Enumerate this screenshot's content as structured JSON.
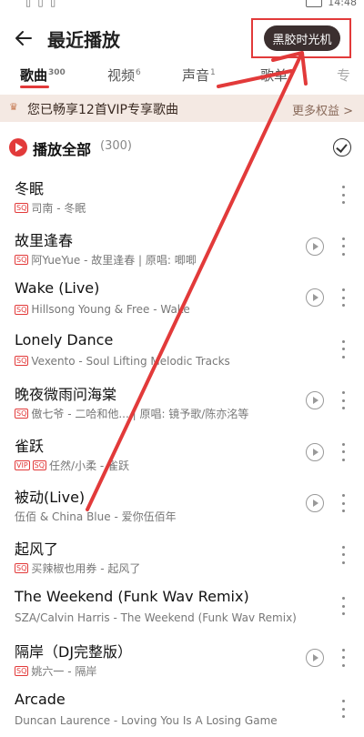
{
  "status": {
    "left_icons": "▯ ▯ ▯",
    "time": "14:48"
  },
  "header": {
    "title": "最近播放",
    "vinyl_button": "黑胶时光机"
  },
  "tabs": [
    {
      "label": "歌曲",
      "count": "300"
    },
    {
      "label": "视频",
      "count": "6"
    },
    {
      "label": "声音",
      "count": "1"
    },
    {
      "label": "歌单",
      "count": ""
    },
    {
      "label": "专",
      "count": ""
    }
  ],
  "vip_banner": {
    "text": "您已畅享12首VIP专享歌曲",
    "more": "更多权益 >"
  },
  "play_all": {
    "label": "播放全部",
    "count": "(300)"
  },
  "songs": [
    {
      "name": "冬眠",
      "meta": "司南 - 冬眠",
      "badges": [
        "SQ"
      ],
      "mv": false
    },
    {
      "name": "故里逢春",
      "meta": "阿YueYue - 故里逢春 | 原唱: 唧唧",
      "badges": [
        "SQ"
      ],
      "mv": true
    },
    {
      "name": "Wake (Live)",
      "meta": "Hillsong Young & Free - Wake",
      "badges": [
        "SQ"
      ],
      "mv": true
    },
    {
      "name": "Lonely Dance",
      "meta": "Vexento - Soul Lifting Melodic Tracks",
      "badges": [
        "SQ"
      ],
      "mv": false
    },
    {
      "name": "晚夜微雨问海棠",
      "meta": "傲七爷 - 二哈和他... | 原唱: 镜予歌/陈亦洺等",
      "badges": [
        "SQ"
      ],
      "mv": true
    },
    {
      "name": "雀跃",
      "meta": "任然/小柔 - 雀跃",
      "badges": [
        "VIP",
        "SQ"
      ],
      "mv": true
    },
    {
      "name": "被动(Live)",
      "meta": "伍佰 & China Blue - 爱你伍佰年",
      "badges": [],
      "mv": true
    },
    {
      "name": "起风了",
      "meta": "买辣椒也用券 - 起风了",
      "badges": [
        "SQ"
      ],
      "mv": false
    },
    {
      "name": "The Weekend (Funk Wav Remix)",
      "meta": "SZA/Calvin Harris - The Weekend (Funk Wav Remix)",
      "badges": [],
      "mv": false
    },
    {
      "name": "隔岸（DJ完整版）",
      "meta": "姚六一 - 隔岸",
      "badges": [
        "SQ"
      ],
      "mv": true
    },
    {
      "name": "Arcade",
      "meta": "Duncan Laurence - Loving You Is A Losing Game",
      "badges": [],
      "mv": false
    }
  ],
  "colors": {
    "accent": "#e23a3a",
    "vip_bg": "#f4e9e3",
    "vinyl_bg": "#3b2f2f"
  }
}
